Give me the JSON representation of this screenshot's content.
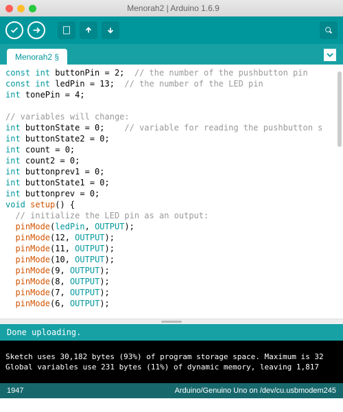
{
  "window": {
    "title": "Menorah2 | Arduino 1.6.9"
  },
  "tab": {
    "label": "Menorah2 §"
  },
  "code": [
    {
      "t": "decl",
      "kw": "const int",
      "name": "buttonPin",
      "val": "2",
      "cmt": "// the number of the pushbutton pin"
    },
    {
      "t": "decl",
      "kw": "const int",
      "name": "ledPin",
      "val": "13",
      "cmt": "// the number of the LED pin"
    },
    {
      "t": "decl",
      "kw": "int",
      "name": "tonePin",
      "val": "4"
    },
    {
      "t": "blank"
    },
    {
      "t": "cmt",
      "text": "// variables will change:"
    },
    {
      "t": "decl",
      "kw": "int",
      "name": "buttonState",
      "val": "0",
      "cmt": "// variable for reading the pushbutton s"
    },
    {
      "t": "decl",
      "kw": "int",
      "name": "buttonState2",
      "val": "0"
    },
    {
      "t": "decl",
      "kw": "int",
      "name": "count",
      "val": "0"
    },
    {
      "t": "decl",
      "kw": "int",
      "name": "count2",
      "val": "0"
    },
    {
      "t": "decl",
      "kw": "int",
      "name": "buttonprev1",
      "val": "0"
    },
    {
      "t": "decl",
      "kw": "int",
      "name": "buttonState1",
      "val": "0"
    },
    {
      "t": "decl",
      "kw": "int",
      "name": "buttonprev",
      "val": "0"
    },
    {
      "t": "func",
      "ret": "void",
      "name": "setup",
      "sig": "()",
      "open": "{"
    },
    {
      "t": "cmt",
      "indent": 1,
      "text": "// initialize the LED pin as an output:"
    },
    {
      "t": "call",
      "indent": 1,
      "fn": "pinMode",
      "args": [
        "ledPin",
        "OUTPUT"
      ]
    },
    {
      "t": "call",
      "indent": 1,
      "fn": "pinMode",
      "args": [
        "12",
        "OUTPUT"
      ]
    },
    {
      "t": "call",
      "indent": 1,
      "fn": "pinMode",
      "args": [
        "11",
        "OUTPUT"
      ]
    },
    {
      "t": "call",
      "indent": 1,
      "fn": "pinMode",
      "args": [
        "10",
        "OUTPUT"
      ]
    },
    {
      "t": "call",
      "indent": 1,
      "fn": "pinMode",
      "args": [
        "9",
        "OUTPUT"
      ]
    },
    {
      "t": "call",
      "indent": 1,
      "fn": "pinMode",
      "args": [
        "8",
        "OUTPUT"
      ]
    },
    {
      "t": "call",
      "indent": 1,
      "fn": "pinMode",
      "args": [
        "7",
        "OUTPUT"
      ]
    },
    {
      "t": "call",
      "indent": 1,
      "fn": "pinMode",
      "args": [
        "6",
        "OUTPUT"
      ]
    }
  ],
  "status": {
    "text": "Done uploading."
  },
  "console": {
    "line1": "Sketch uses 30,182 bytes (93%) of program storage space. Maximum is 32",
    "line2": "Global variables use 231 bytes (11%) of dynamic memory, leaving 1,817 "
  },
  "bottom": {
    "line": "1947",
    "board": "Arduino/Genuino Uno on /dev/cu.usbmodem245"
  }
}
